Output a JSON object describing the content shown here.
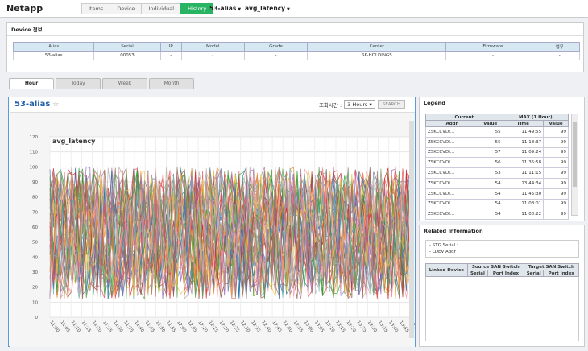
{
  "app": {
    "title": "Netapp"
  },
  "nav": {
    "tabs": [
      {
        "label": "Items"
      },
      {
        "label": "Device"
      },
      {
        "label": "Individual"
      },
      {
        "label": "History",
        "active": true
      }
    ],
    "alias_dropdown": "53-alias",
    "metric_dropdown": "avg_latency"
  },
  "device_panel": {
    "title": "Device 정보",
    "headers": [
      "Alias",
      "Serial",
      "IP",
      "Model",
      "Grade",
      "Center",
      "Firmware",
      "업무"
    ],
    "row": [
      "53-alias",
      "00053",
      "-",
      "-",
      "-",
      "SK-HOLDINGS",
      "-",
      "-"
    ]
  },
  "time_tabs": [
    {
      "label": "Hour",
      "active": true
    },
    {
      "label": "Today"
    },
    {
      "label": "Week"
    },
    {
      "label": "Month"
    }
  ],
  "chart_panel": {
    "title": "53-alias",
    "time_label": "조회시간 :",
    "time_value": "3 Hours",
    "search_label": "SEARCH"
  },
  "chart_data": {
    "type": "line",
    "title": "avg_latency",
    "xlabel": "",
    "ylabel": "",
    "ylim": [
      0,
      120
    ],
    "yticks": [
      0,
      10,
      20,
      30,
      40,
      50,
      60,
      70,
      80,
      90,
      100,
      110,
      120
    ],
    "xticks": [
      "11:00",
      "11:05",
      "11:10",
      "11:15",
      "11:20",
      "11:25",
      "11:30",
      "11:35",
      "11:40",
      "11:45",
      "11:50",
      "11:55",
      "12:00",
      "12:05",
      "12:10",
      "12:15",
      "12:20",
      "12:25",
      "12:30",
      "12:35",
      "12:40",
      "12:45",
      "12:50",
      "12:55",
      "13:00",
      "13:05",
      "13:10",
      "13:15",
      "13:20",
      "13:25",
      "13:30",
      "13:35",
      "13:40",
      "13:45",
      "13:50"
    ],
    "value_range": [
      12,
      100
    ],
    "series_count": 40,
    "grid": true
  },
  "legend": {
    "title": "Legend",
    "head_current": "Current",
    "head_max": "MAX (1 Hour)",
    "cols": [
      "Addr",
      "Value",
      "Time",
      "Value"
    ],
    "rows": [
      [
        "ZSKCCVDI...",
        "55",
        "11:49:55",
        "99"
      ],
      [
        "ZSKCCVDI...",
        "55",
        "11:18:37",
        "99"
      ],
      [
        "ZSKCCVDI...",
        "57",
        "11:09:24",
        "99"
      ],
      [
        "ZSKCCVDI...",
        "56",
        "11:35:58",
        "99"
      ],
      [
        "ZSKCCVDI...",
        "53",
        "11:11:15",
        "99"
      ],
      [
        "ZSKCCVDI...",
        "54",
        "13:44:34",
        "99"
      ],
      [
        "ZSKCCVDI...",
        "54",
        "11:45:30",
        "99"
      ],
      [
        "ZSKCCVDI...",
        "54",
        "11:03:01",
        "99"
      ],
      [
        "ZSKCCVDI...",
        "54",
        "11:00:22",
        "99"
      ]
    ]
  },
  "related": {
    "title": "Related Information",
    "stg_serial": "- STG Serial :",
    "ldev_addr": "- LDEV Addr :",
    "linked_device": "Linked Device",
    "source_switch": "Source SAN Switch",
    "target_switch": "Target SAN Switch",
    "serial": "Serial",
    "port_index": "Port Index"
  },
  "colors": {
    "accent": "#28b463",
    "title_blue": "#1f5fa8"
  }
}
